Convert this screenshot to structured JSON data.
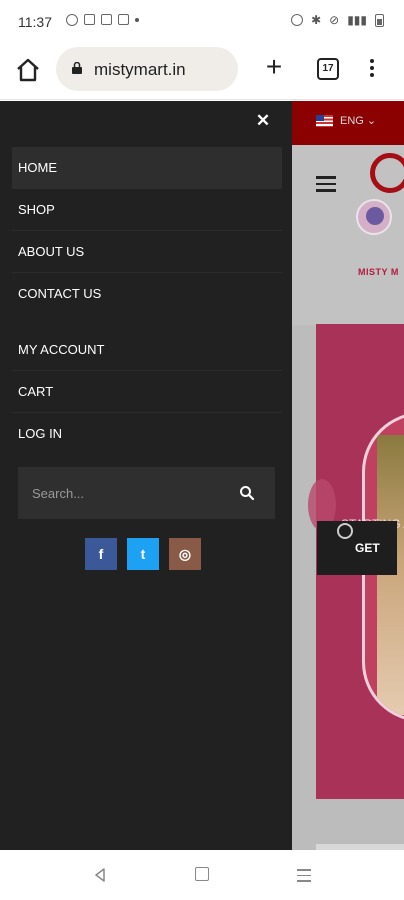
{
  "status_bar": {
    "time": "11:37"
  },
  "browser": {
    "url": "mistymart.in",
    "tab_count": "17"
  },
  "site": {
    "language": "ENG",
    "hero_text": "STARTING A",
    "hero_button": "GET",
    "logo_text": "MISTY M"
  },
  "drawer": {
    "menu": [
      {
        "label": "HOME",
        "active": true
      },
      {
        "label": "SHOP"
      },
      {
        "label": "ABOUT US"
      },
      {
        "label": "CONTACT US"
      },
      {
        "label": "MY ACCOUNT"
      },
      {
        "label": "CART"
      },
      {
        "label": "LOG IN"
      }
    ],
    "search_placeholder": "Search...",
    "socials": [
      {
        "name": "facebook",
        "glyph": "f"
      },
      {
        "name": "twitter",
        "glyph": "t"
      },
      {
        "name": "instagram",
        "glyph": "◎"
      }
    ]
  },
  "colors": {
    "drawer_bg": "#212121",
    "topbar_red": "#8b0000",
    "hero_pink": "#a93259",
    "facebook": "#3b5998",
    "twitter": "#1da1f2",
    "instagram": "#8a5a48"
  }
}
